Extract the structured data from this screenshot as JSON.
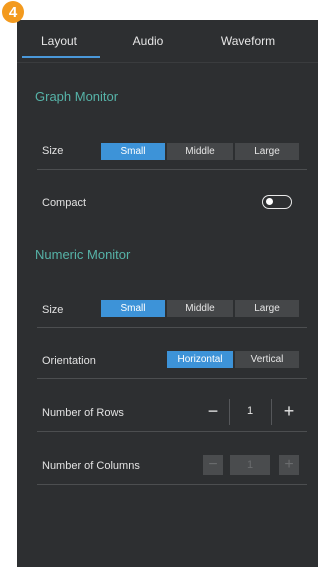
{
  "badge": {
    "number": "4"
  },
  "tabs": [
    {
      "label": "Layout",
      "active": true
    },
    {
      "label": "Audio",
      "active": false
    },
    {
      "label": "Waveform",
      "active": false
    }
  ],
  "graph_monitor": {
    "title": "Graph Monitor",
    "size": {
      "label": "Size",
      "options": [
        "Small",
        "Middle",
        "Large"
      ],
      "selected": "Small"
    },
    "compact": {
      "label": "Compact",
      "enabled": false
    }
  },
  "numeric_monitor": {
    "title": "Numeric Monitor",
    "size": {
      "label": "Size",
      "options": [
        "Small",
        "Middle",
        "Large"
      ],
      "selected": "Small"
    },
    "orientation": {
      "label": "Orientation",
      "options": [
        "Horizontal",
        "Vertical"
      ],
      "selected": "Horizontal"
    },
    "rows": {
      "label": "Number of Rows",
      "value": "1",
      "minus": "−",
      "plus": "+"
    },
    "columns": {
      "label": "Number of Columns",
      "value": "1",
      "minus": "−",
      "plus": "+",
      "disabled": true
    }
  },
  "colors": {
    "panel_bg": "#2d2f31",
    "accent": "#3d93d8",
    "section_title": "#56b3a8",
    "badge": "#f39a1e"
  }
}
